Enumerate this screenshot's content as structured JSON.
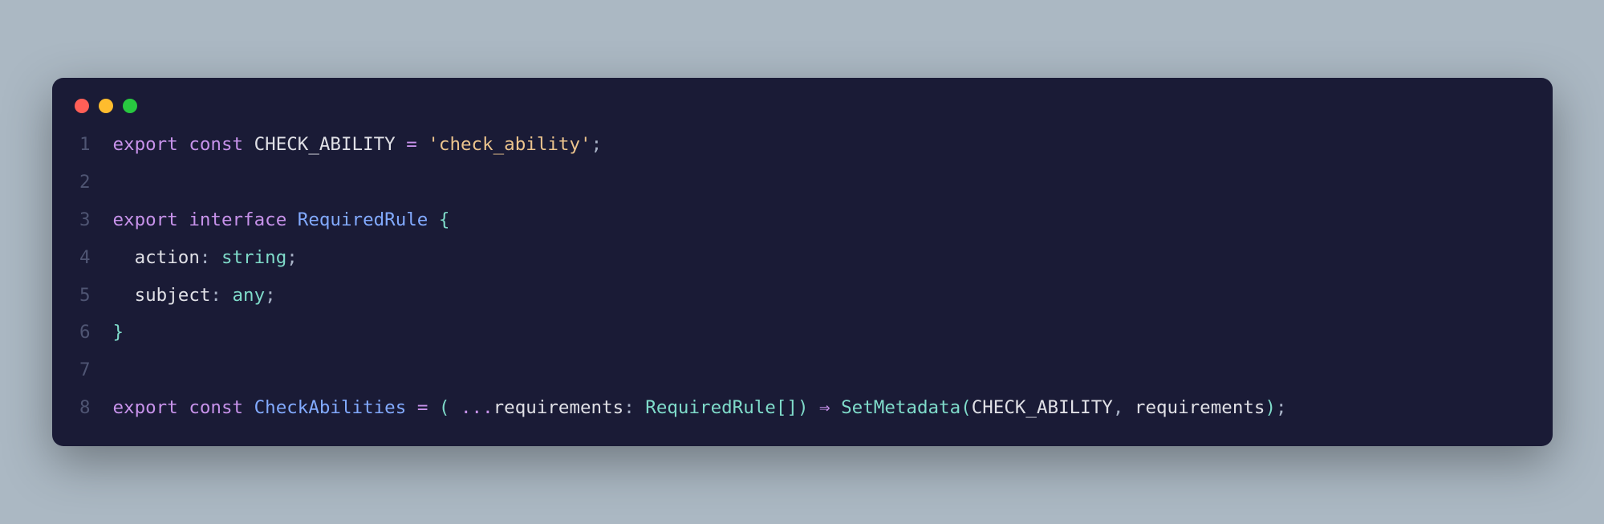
{
  "window": {
    "dots": [
      "red",
      "yellow",
      "green"
    ]
  },
  "code": {
    "lines": [
      {
        "n": "1",
        "tokens": [
          {
            "c": "kw-export",
            "t": "export"
          },
          {
            "c": "",
            "t": " "
          },
          {
            "c": "kw-const",
            "t": "const"
          },
          {
            "c": "",
            "t": " "
          },
          {
            "c": "ident-const",
            "t": "CHECK_ABILITY"
          },
          {
            "c": "",
            "t": " "
          },
          {
            "c": "op",
            "t": "="
          },
          {
            "c": "",
            "t": " "
          },
          {
            "c": "string",
            "t": "'check_ability'"
          },
          {
            "c": "punct-dim",
            "t": ";"
          }
        ]
      },
      {
        "n": "2",
        "tokens": []
      },
      {
        "n": "3",
        "tokens": [
          {
            "c": "kw-export",
            "t": "export"
          },
          {
            "c": "",
            "t": " "
          },
          {
            "c": "kw-interface",
            "t": "interface"
          },
          {
            "c": "",
            "t": " "
          },
          {
            "c": "ident-type",
            "t": "RequiredRule"
          },
          {
            "c": "",
            "t": " "
          },
          {
            "c": "punct",
            "t": "{"
          }
        ]
      },
      {
        "n": "4",
        "tokens": [
          {
            "c": "",
            "t": "  "
          },
          {
            "c": "ident-prop",
            "t": "action"
          },
          {
            "c": "punct-dim",
            "t": ":"
          },
          {
            "c": "",
            "t": " "
          },
          {
            "c": "type-builtin",
            "t": "string"
          },
          {
            "c": "punct-dim",
            "t": ";"
          }
        ]
      },
      {
        "n": "5",
        "tokens": [
          {
            "c": "",
            "t": "  "
          },
          {
            "c": "ident-prop",
            "t": "subject"
          },
          {
            "c": "punct-dim",
            "t": ":"
          },
          {
            "c": "",
            "t": " "
          },
          {
            "c": "type-builtin",
            "t": "any"
          },
          {
            "c": "punct-dim",
            "t": ";"
          }
        ]
      },
      {
        "n": "6",
        "tokens": [
          {
            "c": "punct",
            "t": "}"
          }
        ]
      },
      {
        "n": "7",
        "tokens": []
      },
      {
        "n": "8",
        "tokens": [
          {
            "c": "kw-export",
            "t": "export"
          },
          {
            "c": "",
            "t": " "
          },
          {
            "c": "kw-const",
            "t": "const"
          },
          {
            "c": "",
            "t": " "
          },
          {
            "c": "ident-fn",
            "t": "CheckAbilities"
          },
          {
            "c": "",
            "t": " "
          },
          {
            "c": "op",
            "t": "="
          },
          {
            "c": "",
            "t": " "
          },
          {
            "c": "punct",
            "t": "("
          },
          {
            "c": "",
            "t": " "
          },
          {
            "c": "op",
            "t": "..."
          },
          {
            "c": "ident-param",
            "t": "requirements"
          },
          {
            "c": "punct-dim",
            "t": ":"
          },
          {
            "c": "",
            "t": " "
          },
          {
            "c": "type-ref",
            "t": "RequiredRule"
          },
          {
            "c": "punct",
            "t": "[]"
          },
          {
            "c": "punct",
            "t": ")"
          },
          {
            "c": "",
            "t": " "
          },
          {
            "c": "op",
            "t": "⇒"
          },
          {
            "c": "",
            "t": " "
          },
          {
            "c": "call-fn",
            "t": "SetMetadata"
          },
          {
            "c": "punct",
            "t": "("
          },
          {
            "c": "call-arg",
            "t": "CHECK_ABILITY"
          },
          {
            "c": "punct-dim",
            "t": ","
          },
          {
            "c": "",
            "t": " "
          },
          {
            "c": "call-arg",
            "t": "requirements"
          },
          {
            "c": "punct",
            "t": ")"
          },
          {
            "c": "punct-dim",
            "t": ";"
          }
        ]
      }
    ]
  }
}
